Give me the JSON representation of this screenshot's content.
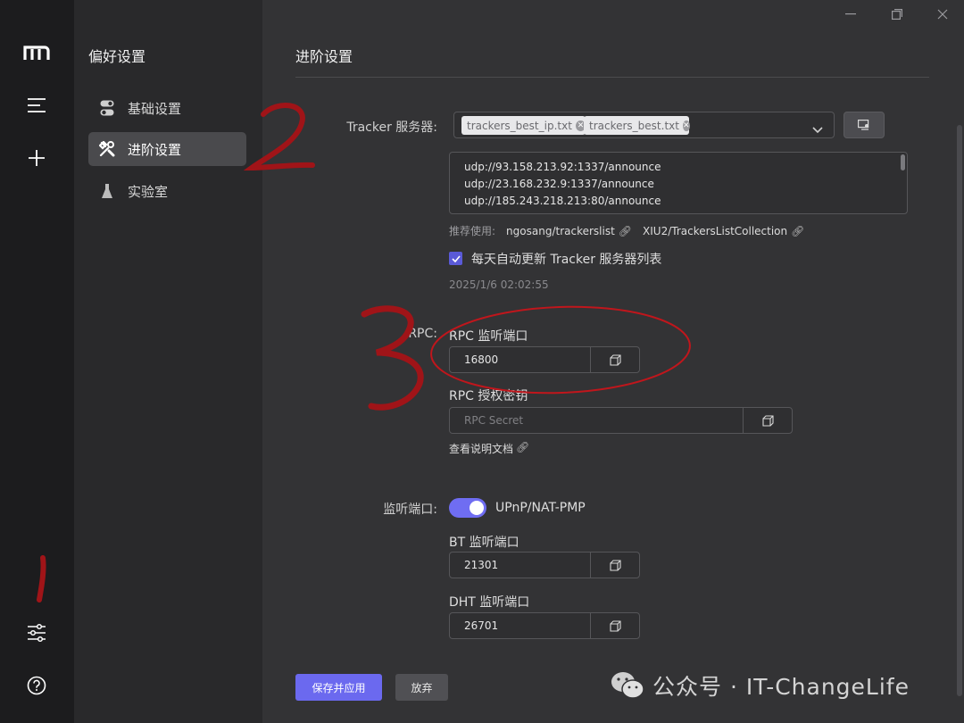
{
  "sidebar": {
    "title": "偏好设置",
    "items": [
      {
        "label": "基础设置",
        "icon": "toggle-switches-icon",
        "active": false
      },
      {
        "label": "进阶设置",
        "icon": "tools-icon",
        "active": true
      },
      {
        "label": "实验室",
        "icon": "flask-icon",
        "active": false
      }
    ]
  },
  "rail": {
    "icons": [
      "motrix-logo-icon",
      "menu-icon",
      "plus-icon",
      "sliders-icon",
      "help-icon"
    ]
  },
  "main": {
    "title": "进阶设置",
    "tracker": {
      "label": "Tracker 服务器:",
      "tags": [
        "trackers_best_ip.txt",
        "trackers_best.txt"
      ],
      "servers": [
        "udp://93.158.213.92:1337/announce",
        "udp://23.168.232.9:1337/announce",
        "udp://185.243.218.213:80/announce"
      ],
      "recommend_prefix": "推荐使用:",
      "recommend_links": [
        "ngosang/trackerslist",
        "XIU2/TrackersListCollection"
      ],
      "auto_update_label": "每天自动更新 Tracker 服务器列表",
      "auto_update_checked": true,
      "last_update": "2025/1/6 02:02:55"
    },
    "rpc": {
      "label": "RPC:",
      "port_label": "RPC 监听端口",
      "port_value": "16800",
      "secret_label": "RPC 授权密钥",
      "secret_placeholder": "RPC Secret",
      "docs_link": "查看说明文档"
    },
    "listen": {
      "label": "监听端口:",
      "upnp_label": "UPnP/NAT-PMP",
      "upnp_enabled": true,
      "bt_label": "BT 监听端口",
      "bt_value": "21301",
      "dht_label": "DHT 监听端口",
      "dht_value": "26701"
    },
    "save_label": "保存并应用",
    "discard_label": "放弃"
  },
  "annotations": [
    "1",
    "2",
    "3"
  ],
  "watermark": "公众号 · IT-ChangeLife",
  "colors": {
    "accent": "#6b69ef",
    "annotation": "#a01418"
  }
}
